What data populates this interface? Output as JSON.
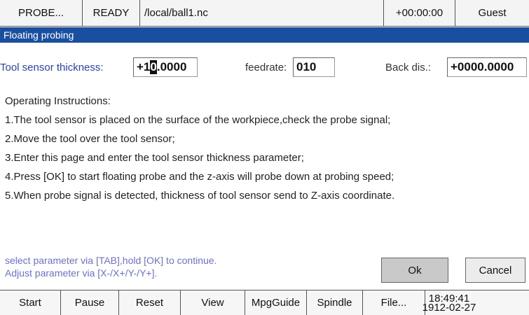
{
  "statusbar": {
    "mode": "PROBE...",
    "state": "READY",
    "file": "/local/ball1.nc",
    "time": "+00:00:00",
    "user": "Guest"
  },
  "dialog": {
    "title": "Floating probing",
    "tool_sensor_label": "Tool sensor thickness:",
    "tool_sensor_value_pre": "+1",
    "tool_sensor_value_cursor": "0",
    "tool_sensor_value_post": ".0000",
    "feedrate_label": "feedrate:",
    "feedrate_value": "010",
    "back_dis_label": "Back dis.:",
    "back_dis_value": "+0000.0000",
    "instructions_heading": "Operating Instructions:",
    "instructions": [
      "1.The tool sensor is placed on the surface of the workpiece,check the probe signal;",
      "2.Move the tool over the tool sensor;",
      "3.Enter this page and enter the tool sensor thickness parameter;",
      "4.Press [OK] to start floating probe and the z-axis will probe down at probing speed;",
      "5.When probe signal is detected, thickness of tool sensor send to Z-axis coordinate."
    ],
    "hint_1": "select parameter via [TAB],hold [OK] to continue.",
    "hint_2": "Adjust parameter via [X-/X+/Y-/Y+].",
    "ok_label": "Ok",
    "cancel_label": "Cancel"
  },
  "softkeys": {
    "start": "Start",
    "pause": "Pause",
    "reset": "Reset",
    "view": "View",
    "mpgguide": "MpgGuide",
    "spindle": "Spindle",
    "file": "File...",
    "clock_time": "18:49:41",
    "clock_date": "1912-02-27"
  },
  "colors": {
    "title_bar": "#1a4fa0",
    "label_blue": "#2d3fa8",
    "hint_blue": "#6a72c8"
  }
}
